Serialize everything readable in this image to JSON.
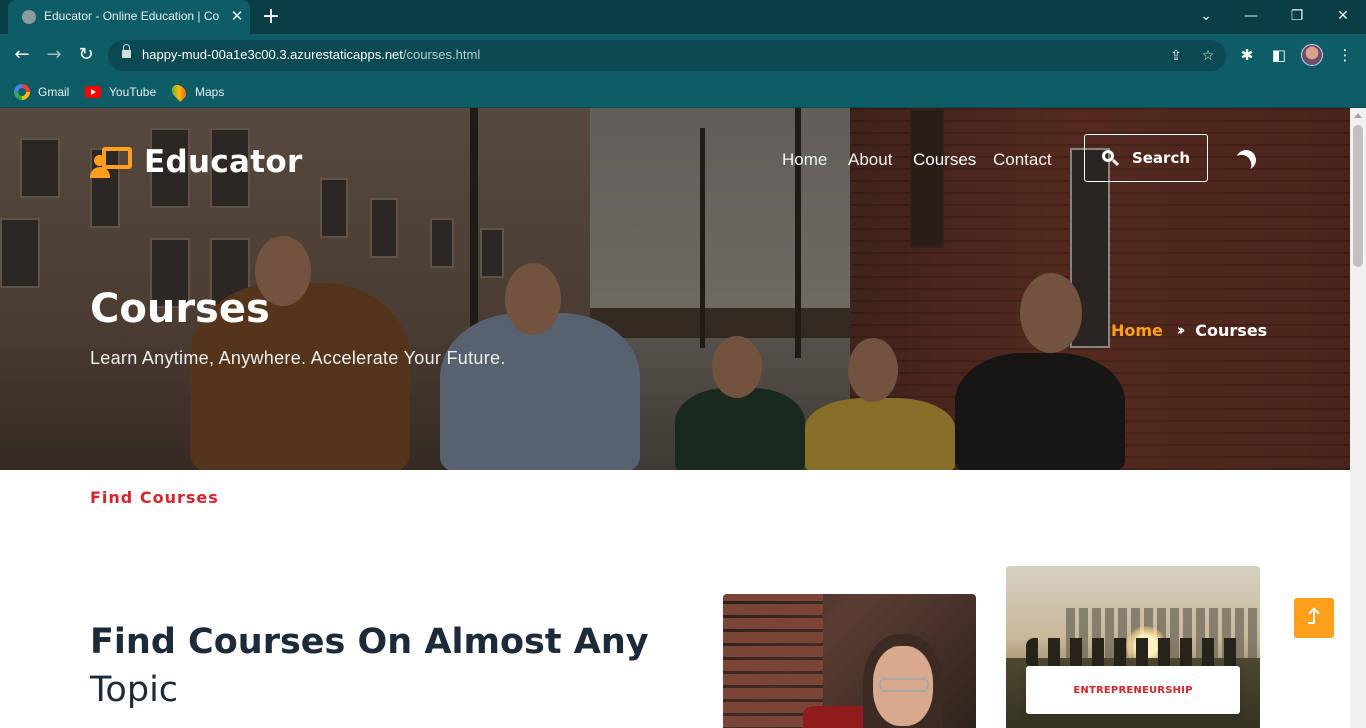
{
  "browser": {
    "tab_title": "Educator - Online Education | Co",
    "url_host": "happy-mud-00a1e3c00.3.azurestaticapps.net",
    "url_path": "/courses.html",
    "bookmarks": [
      {
        "label": "Gmail",
        "icon": "gmail-icon"
      },
      {
        "label": "YouTube",
        "icon": "youtube-icon"
      },
      {
        "label": "Maps",
        "icon": "maps-icon"
      }
    ]
  },
  "site": {
    "brand": "Educator",
    "accent_color": "#ff9f1c",
    "nav": [
      "Home",
      "About",
      "Courses",
      "Contact"
    ],
    "search_label": "Search"
  },
  "hero": {
    "title": "Courses",
    "subtitle": "Learn Anytime, Anywhere. Accelerate Your Future.",
    "breadcrumb_home": "Home",
    "breadcrumb_current": "Courses"
  },
  "section": {
    "kicker": "Find Courses",
    "title_bold": "Find Courses On Almost Any",
    "title_rest": "Topic",
    "kicker_color": "#d8242c"
  },
  "cards": {
    "badge_label": "ENTREPRENEURSHIP"
  }
}
